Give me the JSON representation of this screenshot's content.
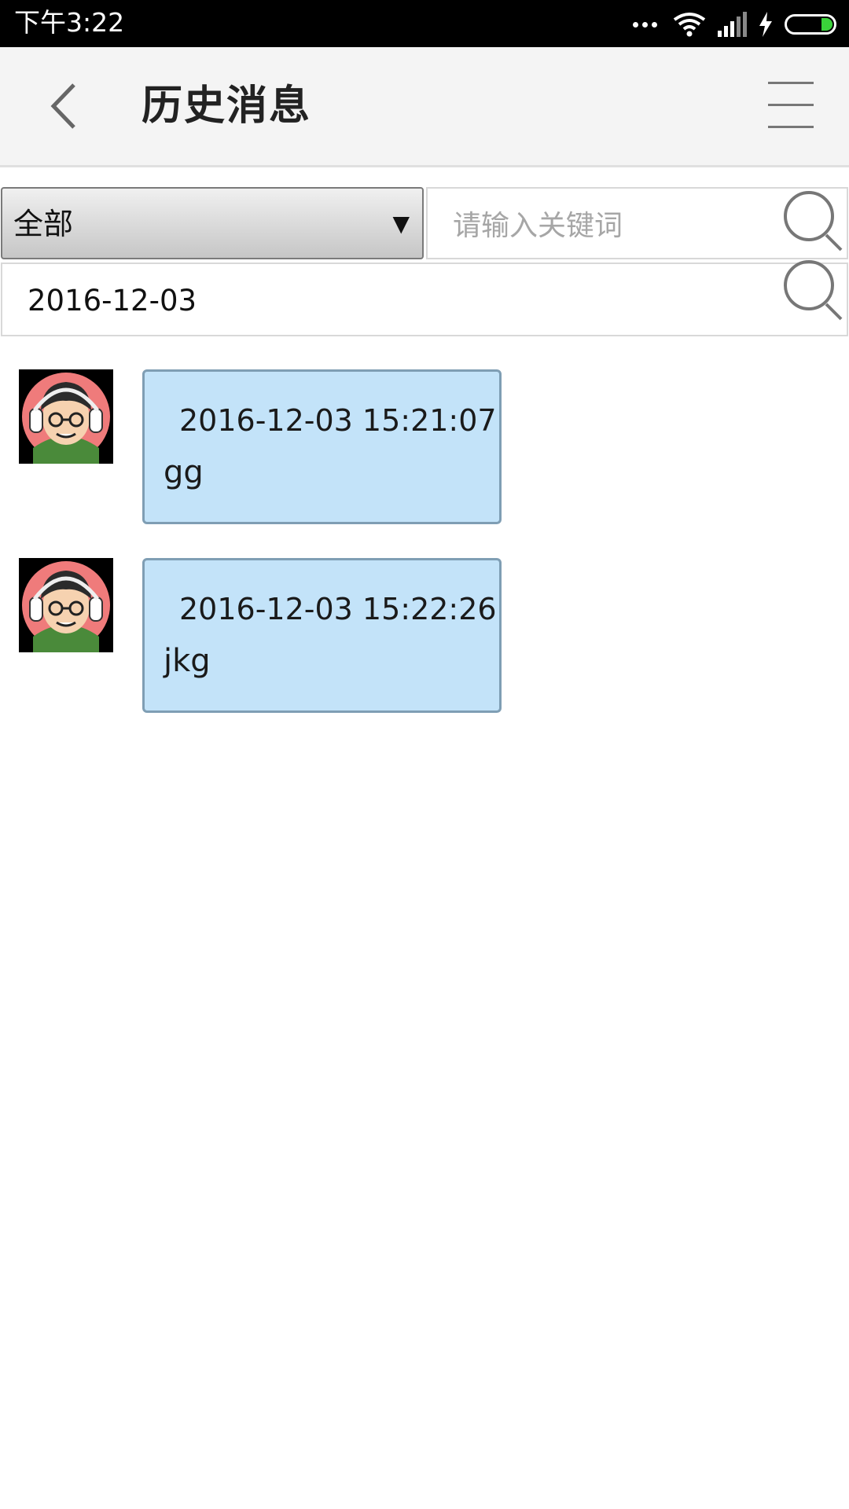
{
  "status_bar": {
    "time": "下午3:22",
    "icons": [
      "more-dots-icon",
      "wifi-icon",
      "signal-icon",
      "charging-icon",
      "battery-icon"
    ]
  },
  "header": {
    "title": "历史消息",
    "back_icon": "chevron-left-icon",
    "menu_icon": "hamburger-menu-icon"
  },
  "filters": {
    "category_select": {
      "value": "全部",
      "arrow": "▼"
    },
    "keyword": {
      "placeholder": "请输入关键词",
      "value": ""
    },
    "date": {
      "value": "2016-12-03"
    },
    "search_icon": "search-icon"
  },
  "messages": [
    {
      "time": "2016-12-03 15:21:07",
      "text": "gg"
    },
    {
      "time": "2016-12-03 15:22:26",
      "text": "jkg"
    }
  ],
  "colors": {
    "bubble_bg": "#c3e3f9",
    "bubble_border": "#7f9eb4",
    "header_bg": "#f4f4f4",
    "battery_green": "#3ad33a"
  }
}
